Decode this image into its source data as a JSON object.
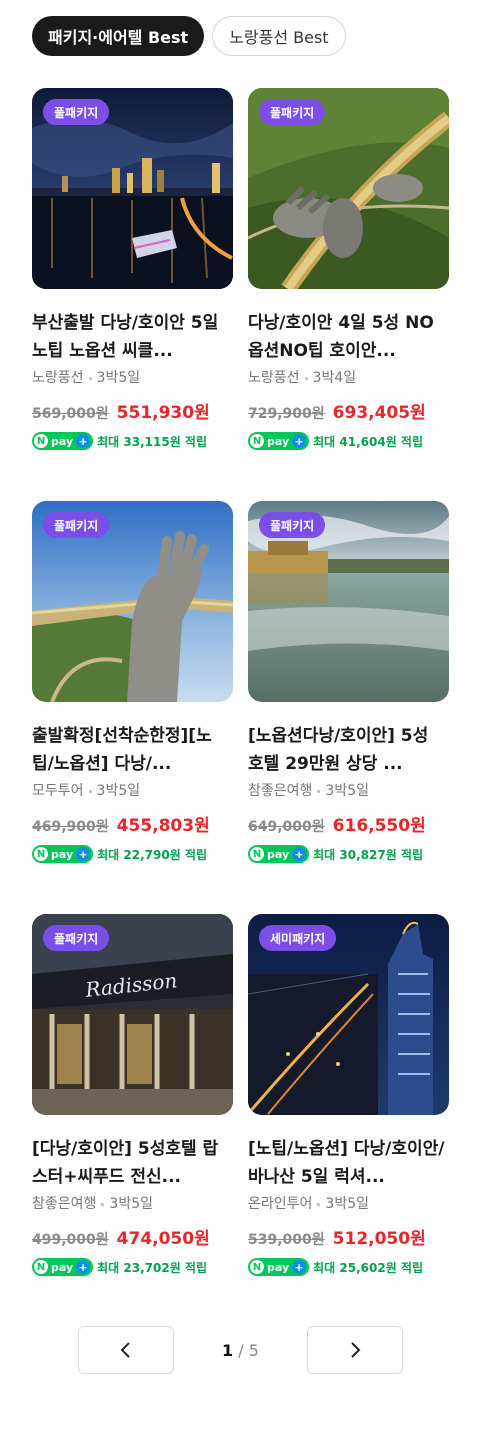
{
  "tabs": [
    {
      "label": "패키지·에어텔 Best",
      "active": true
    },
    {
      "label": "노랑풍선 Best",
      "active": false
    }
  ],
  "products": [
    {
      "badge": "풀패키지",
      "title": "부산출발 다낭/호이안 5일 노팁 노옵션 씨클...",
      "vendor": "노랑풍선",
      "duration": "3박5일",
      "original_price": "569,000원",
      "sale_price": "551,930원",
      "npay_label": "pay",
      "reward": "최대 33,115원 적립"
    },
    {
      "badge": "풀패키지",
      "title": "다낭/호이안 4일 5성 NO옵션NO팁 호이안...",
      "vendor": "노랑풍선",
      "duration": "3박4일",
      "original_price": "729,900원",
      "sale_price": "693,405원",
      "npay_label": "pay",
      "reward": "최대 41,604원 적립"
    },
    {
      "badge": "풀패키지",
      "title": "출발확정[선착순한정][노팁/노옵션] 다낭/...",
      "vendor": "모두투어",
      "duration": "3박5일",
      "original_price": "469,900원",
      "sale_price": "455,803원",
      "npay_label": "pay",
      "reward": "최대 22,790원 적립"
    },
    {
      "badge": "풀패키지",
      "title": "[노옵션다낭/호이안] 5성 호텔 29만원 상당 ...",
      "vendor": "참좋은여행",
      "duration": "3박5일",
      "original_price": "649,000원",
      "sale_price": "616,550원",
      "npay_label": "pay",
      "reward": "최대 30,827원 적립"
    },
    {
      "badge": "풀패키지",
      "title": "[다낭/호이안] 5성호텔 랍스터+씨푸드 전신...",
      "vendor": "참좋은여행",
      "duration": "3박5일",
      "original_price": "499,000원",
      "sale_price": "474,050원",
      "npay_label": "pay",
      "reward": "최대 23,702원 적립"
    },
    {
      "badge": "세미패키지",
      "title": "[노팁/노옵션] 다낭/호이안/바나산 5일 럭셔...",
      "vendor": "온라인투어",
      "duration": "3박5일",
      "original_price": "539,000원",
      "sale_price": "512,050원",
      "npay_label": "pay",
      "reward": "최대 25,602원 적립"
    }
  ],
  "pagination": {
    "current": "1",
    "separator": "/",
    "total": "5"
  },
  "colors": {
    "badge": "#7b4ee8",
    "sale_price": "#e8262a",
    "npay": "#03c75a",
    "reward": "#03a14d"
  }
}
